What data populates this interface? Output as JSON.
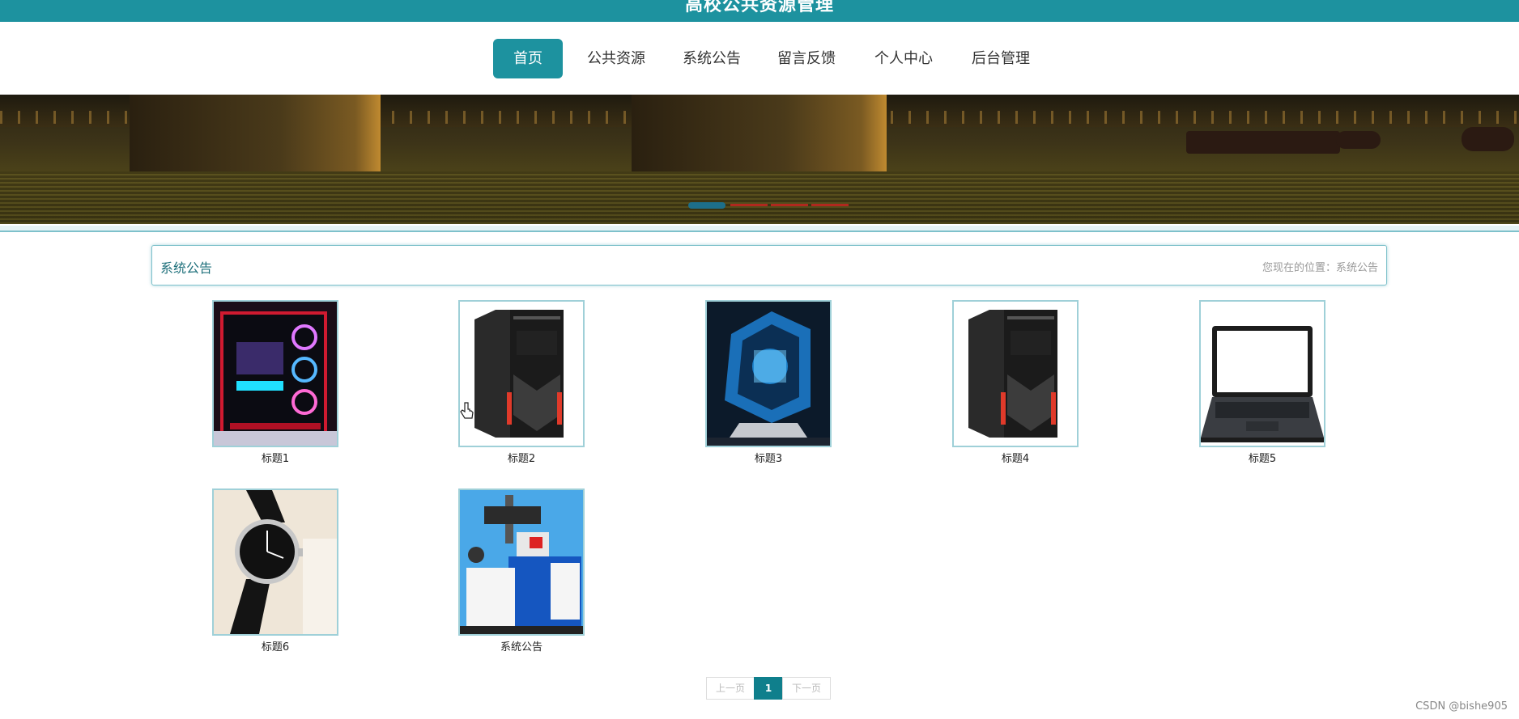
{
  "site": {
    "title": "高校公共资源管理"
  },
  "nav": {
    "items": [
      {
        "label": "首页",
        "active": true
      },
      {
        "label": "公共资源",
        "active": false
      },
      {
        "label": "系统公告",
        "active": false
      },
      {
        "label": "留言反馈",
        "active": false
      },
      {
        "label": "个人中心",
        "active": false
      },
      {
        "label": "后台管理",
        "active": false
      }
    ]
  },
  "banner": {
    "slide_count": 4,
    "active_slide": 1
  },
  "section": {
    "title": "系统公告",
    "breadcrumb": "您现在的位置：系统公告"
  },
  "cards": [
    {
      "caption": "标题1",
      "image": "rgb-pc-case"
    },
    {
      "caption": "标题2",
      "image": "black-tower-pc"
    },
    {
      "caption": "标题3",
      "image": "blue-gaming-pc"
    },
    {
      "caption": "标题4",
      "image": "black-tower-pc"
    },
    {
      "caption": "标题5",
      "image": "laptop"
    },
    {
      "caption": "标题6",
      "image": "wrist-watch"
    },
    {
      "caption": "系统公告",
      "image": "laser-welding-machine"
    }
  ],
  "pagination": {
    "prev": "上一页",
    "current": "1",
    "next": "下一页"
  },
  "watermark": "CSDN @bishe905",
  "colors": {
    "primary": "#1d929f",
    "border": "#7ec1cb",
    "pager_active": "#0f7f8c"
  }
}
